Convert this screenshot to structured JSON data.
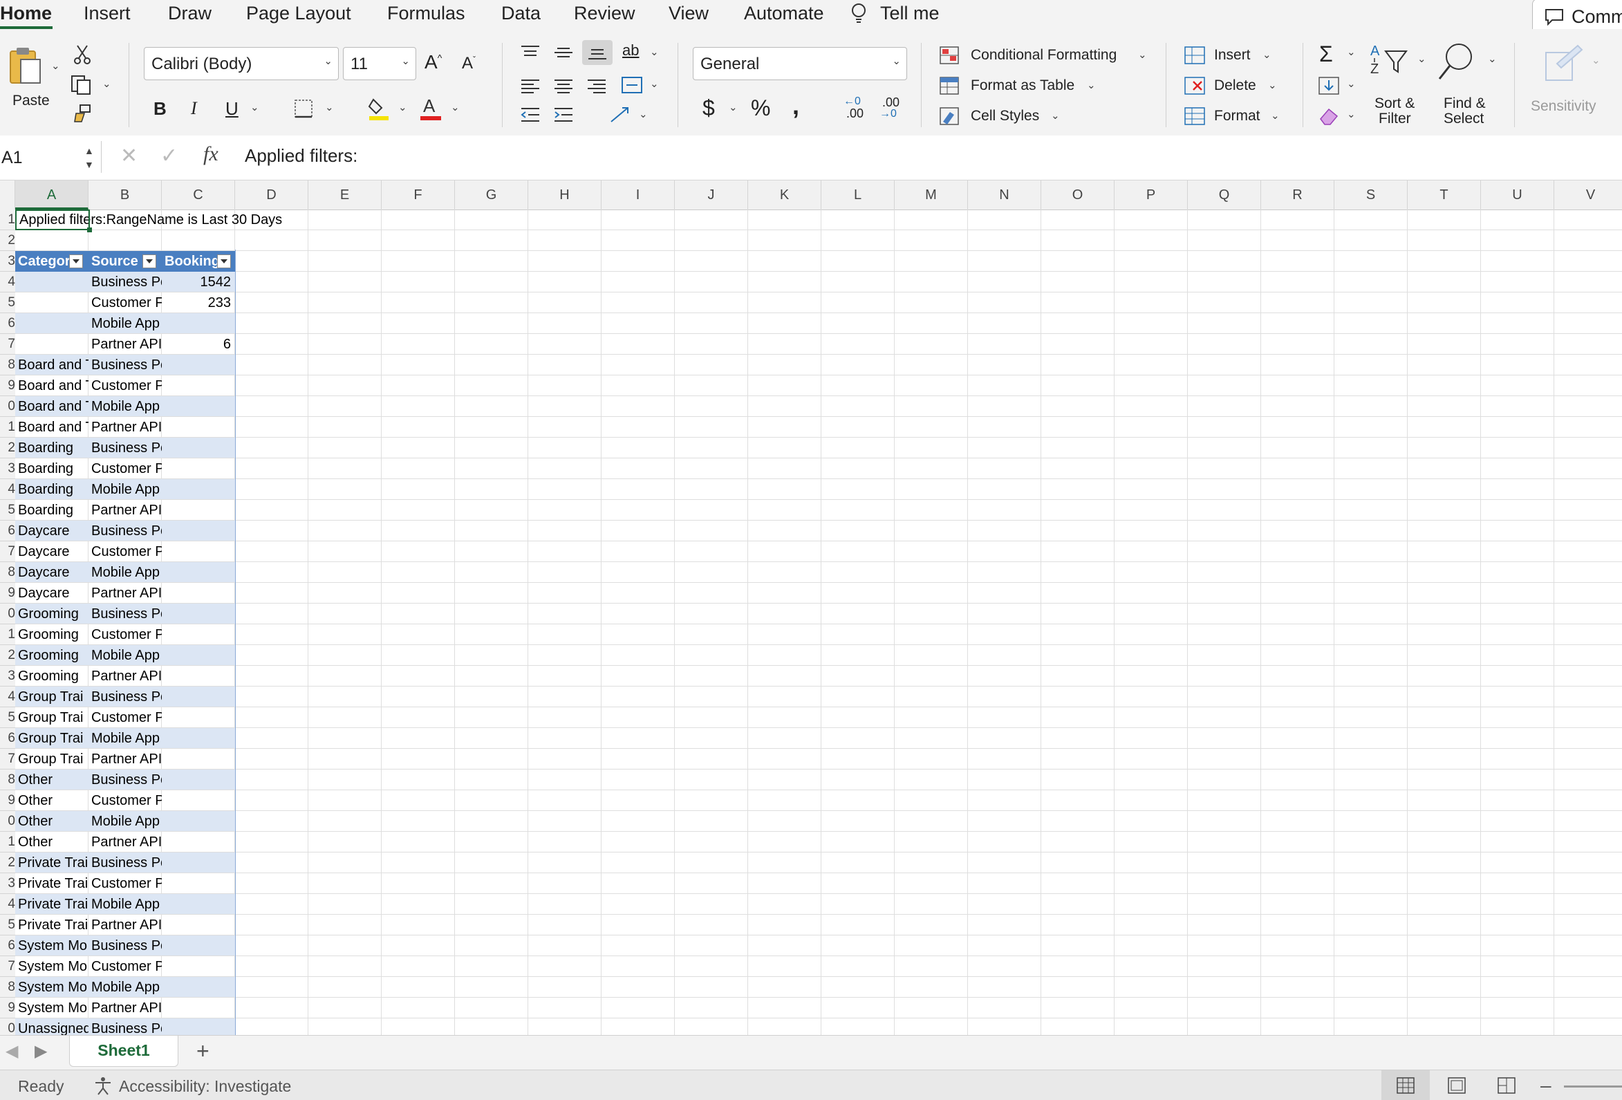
{
  "ribbon": {
    "tabs": [
      "Home",
      "Insert",
      "Draw",
      "Page Layout",
      "Formulas",
      "Data",
      "Review",
      "View",
      "Automate",
      "Tell me"
    ],
    "comments_label": "Comm",
    "paste_label": "Paste",
    "font_name": "Calibri (Body)",
    "font_size": "11",
    "number_format": "General",
    "conditional_formatting": "Conditional Formatting",
    "format_as_table": "Format as Table",
    "cell_styles": "Cell Styles",
    "insert": "Insert",
    "delete": "Delete",
    "format": "Format",
    "sort_filter_1": "Sort &",
    "sort_filter_2": "Filter",
    "find_select_1": "Find &",
    "find_select_2": "Select",
    "sensitivity": "Sensitivity",
    "bold": "B",
    "italic": "I",
    "underline": "U",
    "currency": "$",
    "percent": "%",
    "comma": ",",
    "increase_decimal": ".00",
    "decrease_decimal": ".00",
    "wrap": "ab",
    "fx": "fx"
  },
  "formula_bar": {
    "name_box": "A1",
    "content": "Applied filters:"
  },
  "columns": [
    "A",
    "B",
    "C",
    "D",
    "E",
    "F",
    "G",
    "H",
    "I",
    "J",
    "K",
    "L",
    "M",
    "N",
    "O",
    "P",
    "Q",
    "R",
    "S",
    "T",
    "U",
    "V"
  ],
  "row_numbers": [
    "1",
    "2",
    "3",
    "4",
    "5",
    "6",
    "7",
    "8",
    "9",
    "0",
    "1",
    "2",
    "3",
    "4",
    "5",
    "6",
    "7",
    "8",
    "9",
    "0",
    "1",
    "2",
    "3",
    "4",
    "5",
    "6",
    "7",
    "8",
    "9",
    "0",
    "1",
    "2",
    "3",
    "4",
    "5",
    "6",
    "7",
    "8",
    "9",
    "0"
  ],
  "sheet": {
    "a1": "Applied filters:RangeName is Last 30 Days",
    "headers": [
      "Categor",
      "Source",
      "Booking"
    ],
    "rows": [
      [
        "",
        "Business Po",
        "1542"
      ],
      [
        "",
        "Customer F",
        "233"
      ],
      [
        "",
        "Mobile App",
        ""
      ],
      [
        "",
        "Partner API",
        "6"
      ],
      [
        "Board and T",
        "Business Portal",
        ""
      ],
      [
        "Board and T",
        "Customer Portal",
        ""
      ],
      [
        "Board and T",
        "Mobile App",
        ""
      ],
      [
        "Board and T",
        "Partner API",
        ""
      ],
      [
        "Boarding",
        "Business Portal",
        ""
      ],
      [
        "Boarding",
        "Customer Portal",
        ""
      ],
      [
        "Boarding",
        "Mobile App",
        ""
      ],
      [
        "Boarding",
        "Partner API",
        ""
      ],
      [
        "Daycare",
        "Business Portal",
        ""
      ],
      [
        "Daycare",
        "Customer Portal",
        ""
      ],
      [
        "Daycare",
        "Mobile App",
        ""
      ],
      [
        "Daycare",
        "Partner API",
        ""
      ],
      [
        "Grooming",
        "Business Portal",
        ""
      ],
      [
        "Grooming",
        "Customer Portal",
        ""
      ],
      [
        "Grooming",
        "Mobile App",
        ""
      ],
      [
        "Grooming",
        "Partner API",
        ""
      ],
      [
        "Group Trai",
        "Business Portal",
        ""
      ],
      [
        "Group Trai",
        "Customer Portal",
        ""
      ],
      [
        "Group Trai",
        "Mobile App",
        ""
      ],
      [
        "Group Trai",
        "Partner API",
        ""
      ],
      [
        "Other",
        "Business Portal",
        ""
      ],
      [
        "Other",
        "Customer Portal",
        ""
      ],
      [
        "Other",
        "Mobile App",
        ""
      ],
      [
        "Other",
        "Partner API",
        ""
      ],
      [
        "Private Trai",
        "Business Portal",
        ""
      ],
      [
        "Private Trai",
        "Customer Portal",
        ""
      ],
      [
        "Private Trai",
        "Mobile App",
        ""
      ],
      [
        "Private Trai",
        "Partner API",
        ""
      ],
      [
        "System Mo",
        "Business Portal",
        ""
      ],
      [
        "System Mo",
        "Customer Portal",
        ""
      ],
      [
        "System Mo",
        "Mobile App",
        ""
      ],
      [
        "System Mo",
        "Partner API",
        ""
      ],
      [
        "Unassigned",
        "Business Portal",
        ""
      ]
    ]
  },
  "sheet_tabs": {
    "active": "Sheet1",
    "add": "+"
  },
  "status": {
    "ready": "Ready",
    "accessibility": "Accessibility: Investigate"
  },
  "colors": {
    "accent": "#1e6b3a",
    "table_header": "#4a7fc1",
    "band": "#dce6f4"
  }
}
